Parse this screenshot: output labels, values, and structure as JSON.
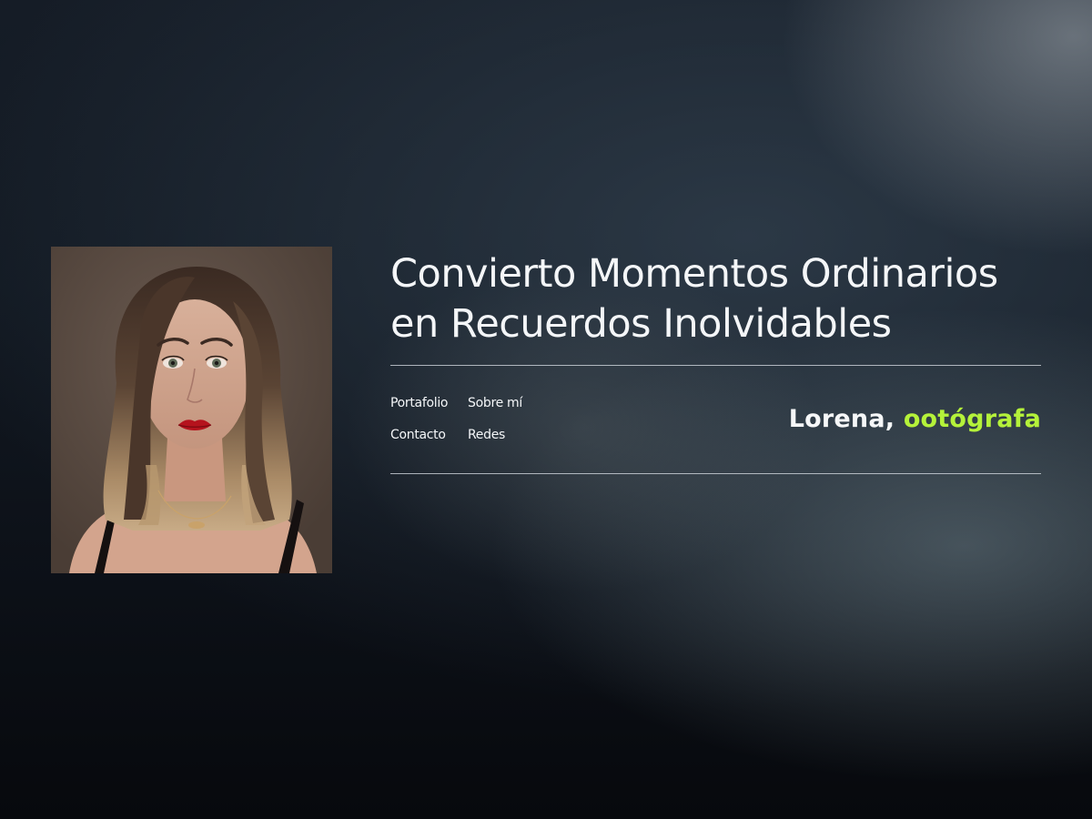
{
  "hero": {
    "headline_line1": "Convierto Momentos Ordinarios",
    "headline_line2": "en Recuerdos Inolvidables"
  },
  "nav": {
    "items": [
      {
        "label": "Portafolio"
      },
      {
        "label": "Sobre mí"
      },
      {
        "label": "Contacto"
      },
      {
        "label": "Redes"
      }
    ]
  },
  "brand": {
    "name": "Lorena,",
    "role": "ootógrafa",
    "accent_color": "#b5f23a"
  },
  "colors": {
    "background": "#0f141b",
    "text": "#f4f6f8"
  }
}
